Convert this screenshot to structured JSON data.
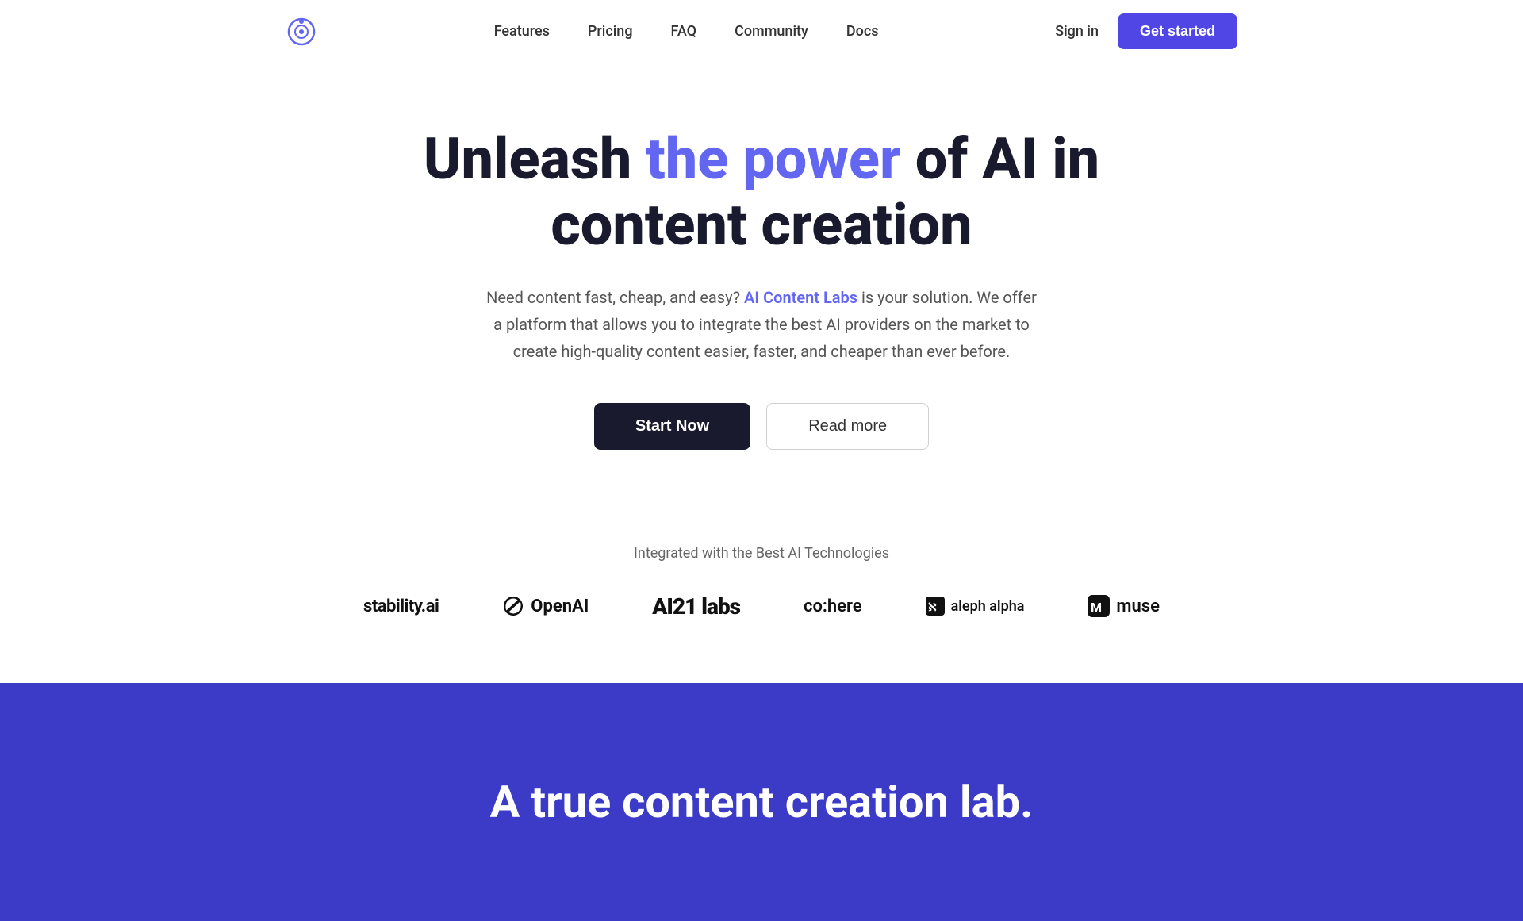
{
  "navbar": {
    "logo_alt": "AI Content Labs Logo",
    "links": [
      {
        "id": "features",
        "label": "Features",
        "href": "#"
      },
      {
        "id": "pricing",
        "label": "Pricing",
        "href": "#"
      },
      {
        "id": "faq",
        "label": "FAQ",
        "href": "#"
      },
      {
        "id": "community",
        "label": "Community",
        "href": "#"
      },
      {
        "id": "docs",
        "label": "Docs",
        "href": "#"
      }
    ],
    "sign_in_label": "Sign in",
    "get_started_label": "Get started"
  },
  "hero": {
    "title_part1": "Unleash ",
    "title_highlight": "the power",
    "title_part2": " of AI in",
    "title_line2": "content creation",
    "subtitle_prefix": "Need content fast, cheap, and easy? ",
    "subtitle_brand": "AI Content Labs",
    "subtitle_suffix": " is your solution. We offer a platform that allows you to integrate the best AI providers on the market to create high-quality content easier, faster, and cheaper than ever before.",
    "start_now_label": "Start Now",
    "read_more_label": "Read more"
  },
  "integrations": {
    "label": "Integrated with the Best AI Technologies",
    "logos": [
      {
        "id": "stability",
        "text": "stability.ai"
      },
      {
        "id": "openai",
        "text": "OpenAI"
      },
      {
        "id": "ai21labs",
        "text": "AI21 labs"
      },
      {
        "id": "cohere",
        "text": "co:here"
      },
      {
        "id": "alephalpha",
        "text": "aleph alpha"
      },
      {
        "id": "muse",
        "text": "muse"
      }
    ]
  },
  "blue_section": {
    "title": "A true content creation lab."
  },
  "colors": {
    "accent": "#6366f1",
    "dark_blue": "#3b3bc8",
    "text_dark": "#1a1a2e",
    "brand_purple": "#4f46e5"
  }
}
